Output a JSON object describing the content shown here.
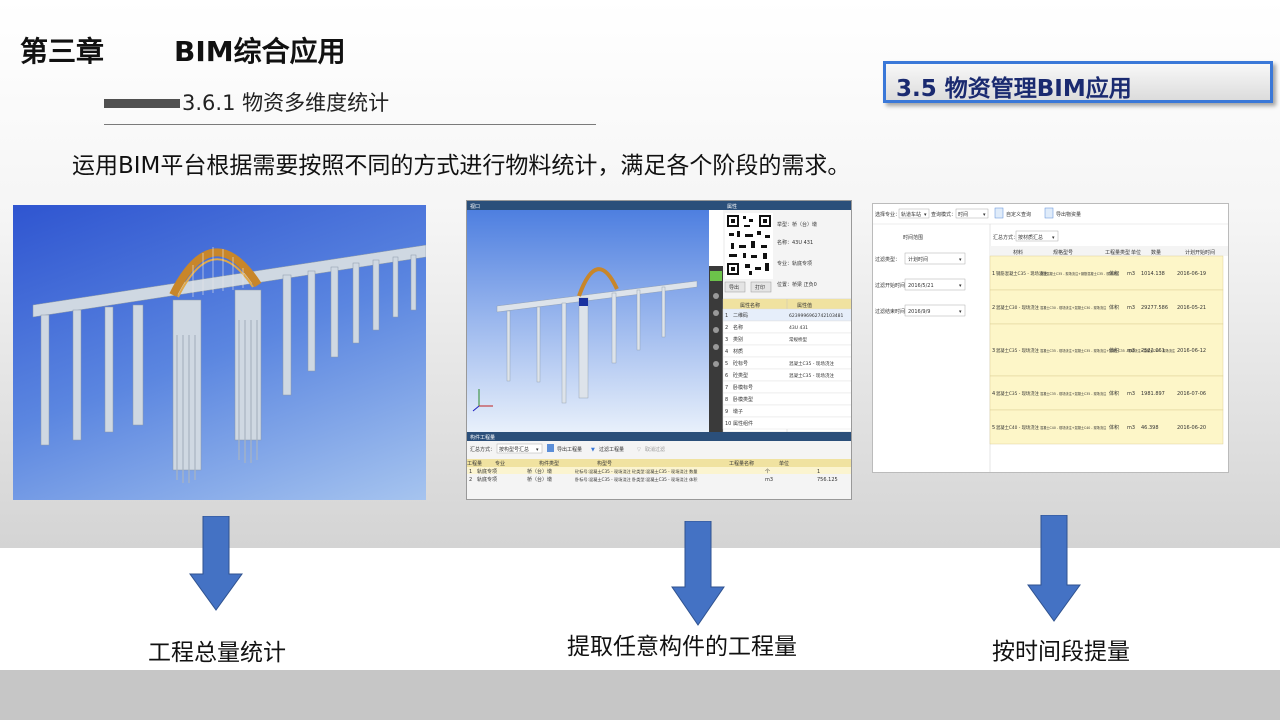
{
  "header": {
    "chapter_num": "第三章",
    "chapter_title": "BIM综合应用",
    "subsection": "3.6.1 物资多维度统计",
    "badge": "3.5 物资管理BIM应用"
  },
  "intro": "运用BIM平台根据需要按照不同的方式进行物料统计，满足各个阶段的需求。",
  "captions": {
    "left": "工程总量统计",
    "middle": "提取任意构件的工程量",
    "right": "按时间段提量"
  },
  "panel2": {
    "view_title": "视口",
    "prop_title": "属性",
    "qr_info": [
      "举型：桥（台）墩",
      "名称：43U 431",
      "专业：轨底专项",
      "位置：桥梁 正负0"
    ],
    "btn_export": "导出",
    "btn_print": "打印",
    "prop_headers": [
      "属性名称",
      "属性值"
    ],
    "props": [
      [
        "二维码",
        "6239996962742103481"
      ],
      [
        "名称",
        "43U 431"
      ],
      [
        "类别",
        "常规桥型"
      ],
      [
        "材质",
        ""
      ],
      [
        "砼标号",
        "混凝土C35 - 现场浇注"
      ],
      [
        "砼类型",
        "混凝土C35 - 现场浇注"
      ],
      [
        "卧模标号",
        ""
      ],
      [
        "卧模类型",
        ""
      ],
      [
        "墩子",
        ""
      ],
      [
        "属性组件",
        ""
      ]
    ],
    "qty_title": "构件工程量",
    "toolbar": {
      "mode_label": "汇总方式：",
      "mode_value": "按构型号汇总",
      "export": "导出工程量",
      "filter": "过滤工程量",
      "cancel": "取消过滤"
    },
    "table_headers": [
      "专业",
      "构件类型",
      "构型号",
      "工程量名称",
      "单位",
      "工程量"
    ],
    "rows": [
      [
        "1",
        "轨底专项",
        "桥（台）墩",
        "砼标号:混凝土C35 - 现场浇注  砼类型:混凝土C35 - 现场浇注  数量",
        "个",
        "1"
      ],
      [
        "2",
        "轨底专项",
        "桥（台）墩",
        "卧标号:混凝土C35 - 现场浇注  卧类型:混凝土C35 - 现场浇注  体积",
        "m3",
        "756.125"
      ]
    ]
  },
  "panel3": {
    "spec_label": "选择专业：",
    "spec_value": "轨道车站",
    "mode_label": "查询模式：",
    "mode_value": "时间",
    "btn_query": "自定义查询",
    "btn_export": "导出物资量",
    "range_title": "时间范围",
    "summary_label": "汇总方式：",
    "summary_value": "按材质汇总",
    "filters": [
      {
        "label": "过滤类型：",
        "value": "计划时间"
      },
      {
        "label": "过滤开始时间：",
        "value": "2016/5/21"
      },
      {
        "label": "过滤结束时间：",
        "value": "2016/9/9"
      }
    ],
    "headers": [
      "材料",
      "规格型号",
      "工程量类型",
      "单位",
      "数量",
      "计划开始时间"
    ],
    "rows": [
      [
        "1",
        "钢筋混凝土C35 - 现场浇注",
        "钢筋混凝土C35 - 现场浇注+钢筋混凝土C35 - 现场浇注",
        "体积",
        "m3",
        "1014.138",
        "2016-06-19"
      ],
      [
        "2",
        "混凝土C30 - 现场浇注",
        "混凝土C30 - 现场浇注+混凝土C30 - 现场浇注",
        "体积",
        "m3",
        "29277.586",
        "2016-05-21"
      ],
      [
        "3",
        "混凝土C35 - 现场浇注",
        "混凝土C35 - 现场浇注+混凝土C35 - 现场浇注+混凝土C35 - 现场浇注+混凝土C35 - 现场浇注",
        "体积",
        "m3",
        "2522.061",
        "2016-06-12"
      ],
      [
        "4",
        "混凝土C35 - 现场浇注",
        "混凝土C35 - 现场浇注+混凝土C35 - 现场浇注",
        "体积",
        "m3",
        "1981.897",
        "2016-07-06"
      ],
      [
        "5",
        "混凝土C40 - 现场浇注",
        "混凝土C40 - 现场浇注+混凝土C40 - 现场浇注",
        "体积",
        "m3",
        "46.398",
        "2016-06-20"
      ]
    ]
  }
}
